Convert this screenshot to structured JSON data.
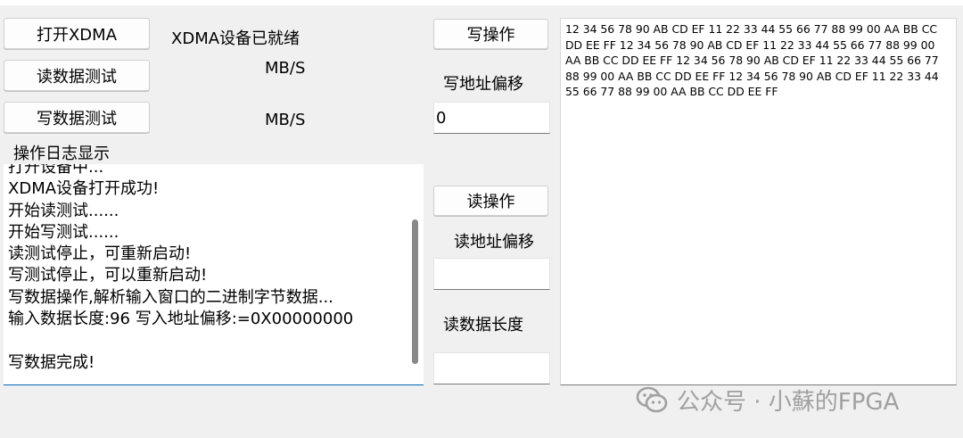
{
  "buttons": {
    "open_xdma": "打开XDMA",
    "read_test": "读数据测试",
    "write_test": "写数据测试",
    "write_op": "写操作",
    "read_op": "读操作"
  },
  "status": {
    "device_ready": "XDMA设备已就绪",
    "read_speed_unit": "MB/S",
    "write_speed_unit": "MB/S"
  },
  "labels": {
    "log_title": "操作日志显示",
    "write_offset": "写地址偏移",
    "read_offset": "读地址偏移",
    "read_length": "读数据长度"
  },
  "fields": {
    "write_offset_value": "0",
    "read_offset_value": "",
    "read_length_value": ""
  },
  "log": {
    "lines": [
      "打开设备中...",
      "XDMA设备打开成功!",
      "开始读测试......",
      "开始写测试......",
      "读测试停止，可重新启动!",
      "写测试停止，可以重新启动!",
      "写数据操作,解析输入窗口的二进制字节数据...",
      "输入数据长度:96 写入地址偏移:=0X00000000",
      "",
      "写数据完成!"
    ]
  },
  "hex_data": "12 34 56 78 90 AB CD EF 11 22 33 44 55 66 77 88 99 00 AA BB CC DD EE FF 12 34 56 78 90 AB CD EF 11 22 33 44 55 66 77 88 99 00 AA BB CC DD EE FF 12 34 56 78 90 AB CD EF 11 22 33 44 55 66 77 88 99 00 AA BB CC DD EE FF 12 34 56 78 90 AB CD EF 11 22 33 44 55 66 77 88 99 00 AA BB CC DD EE FF",
  "watermark": {
    "icon": "wechat-icon",
    "text": "公众号 · 小蘇的FPGA"
  }
}
